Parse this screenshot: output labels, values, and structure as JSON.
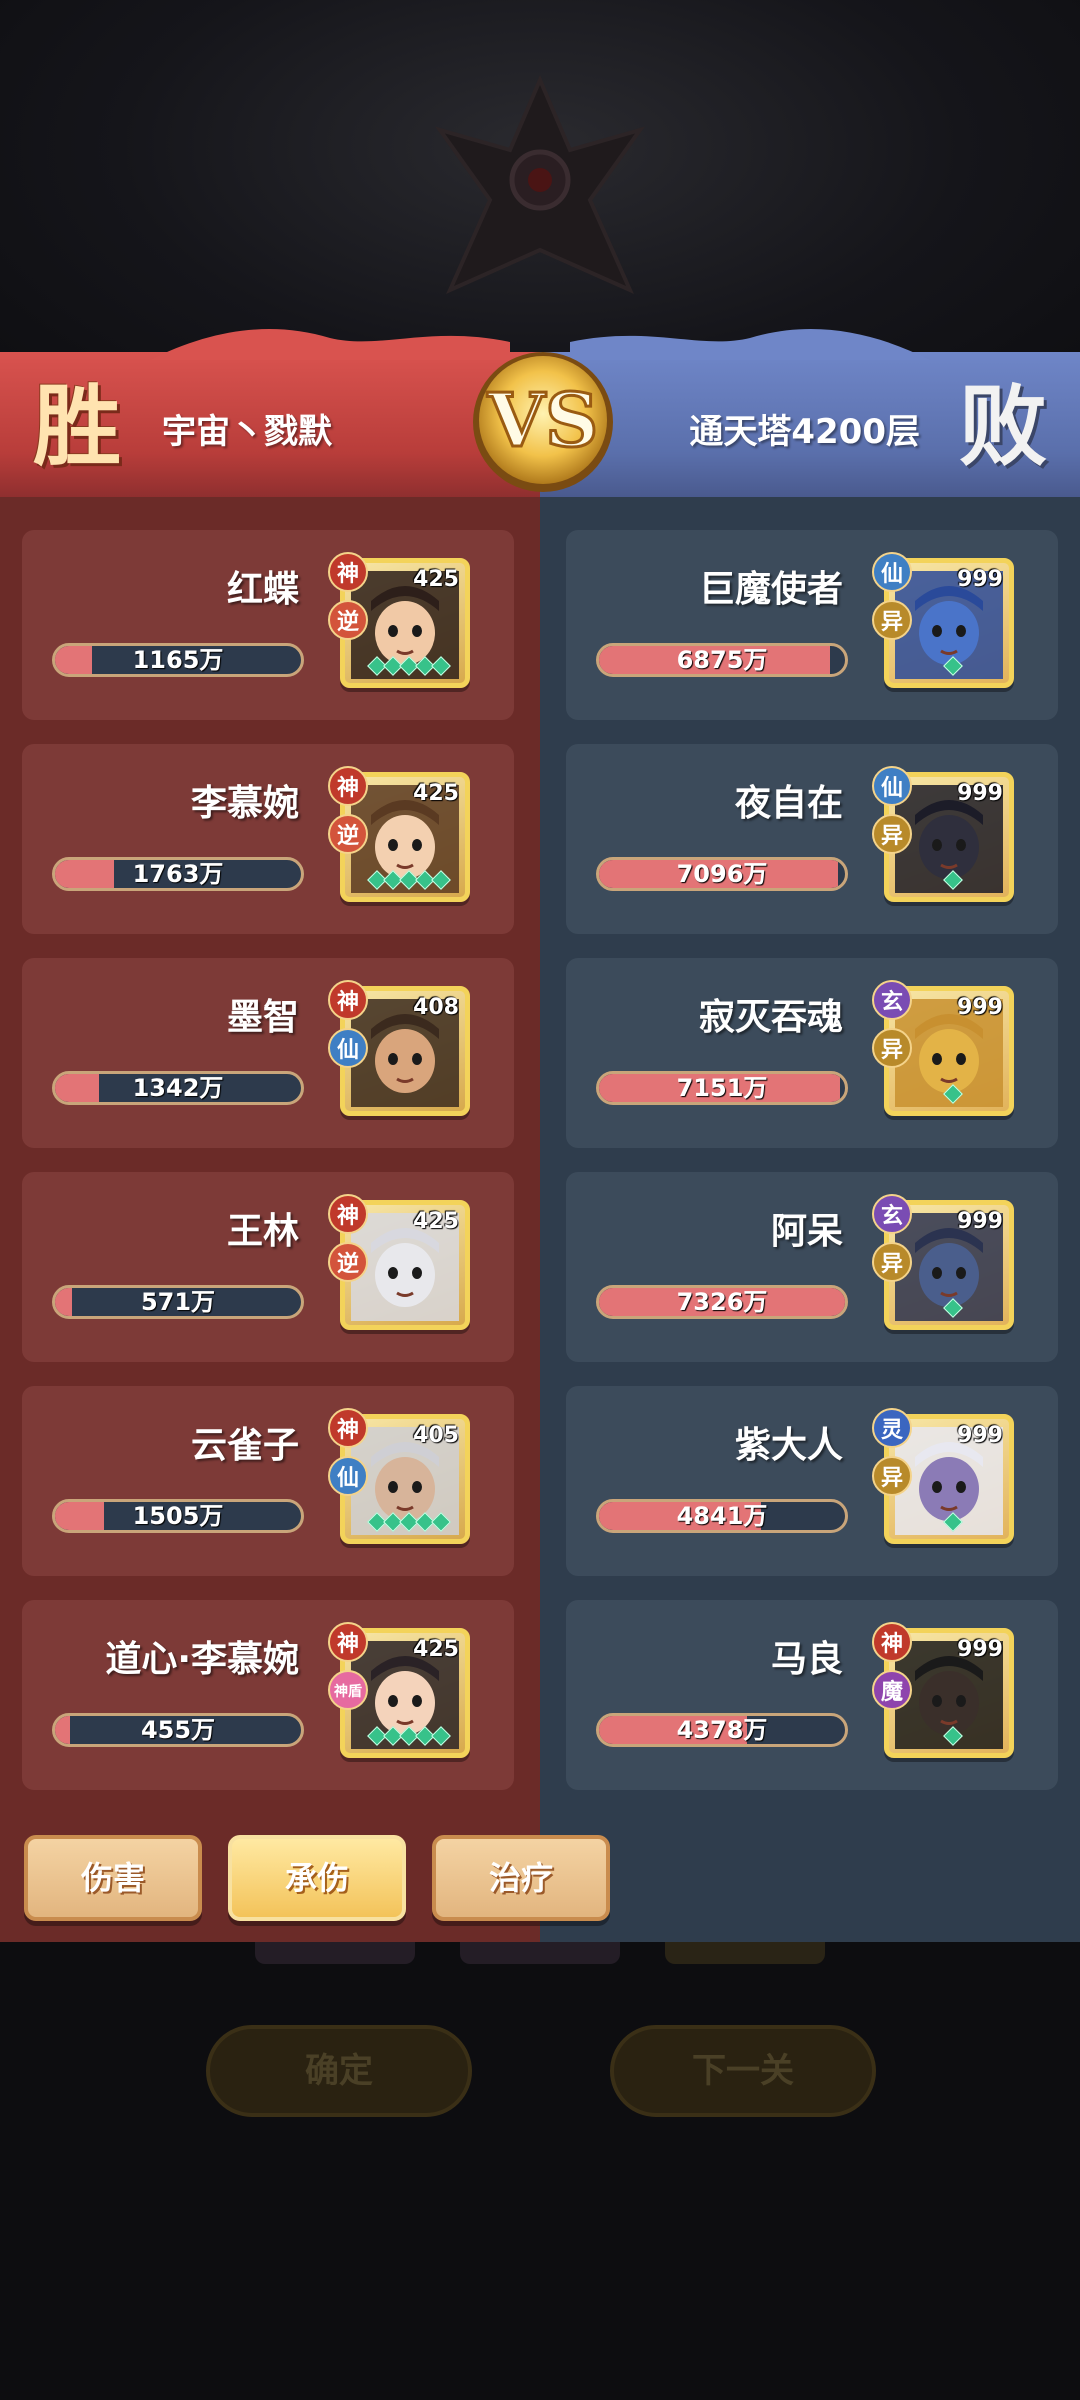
{
  "header": {
    "win_label": "胜",
    "lose_label": "败",
    "vs_label": "VS",
    "left_team": "宇宙丶戮默",
    "right_team": "通天塔4200层"
  },
  "left_heroes": [
    {
      "name": "红蝶",
      "value": "1165万",
      "ratio": 0.15,
      "level": "425",
      "tags": [
        "神",
        "逆"
      ],
      "stars": 5
    },
    {
      "name": "李慕婉",
      "value": "1763万",
      "ratio": 0.24,
      "level": "425",
      "tags": [
        "神",
        "逆"
      ],
      "stars": 5
    },
    {
      "name": "墨智",
      "value": "1342万",
      "ratio": 0.18,
      "level": "408",
      "tags": [
        "神",
        "仙"
      ],
      "stars": 0
    },
    {
      "name": "王林",
      "value": "571万",
      "ratio": 0.07,
      "level": "425",
      "tags": [
        "神",
        "逆"
      ],
      "stars": 0
    },
    {
      "name": "云雀子",
      "value": "1505万",
      "ratio": 0.2,
      "level": "405",
      "tags": [
        "神",
        "仙"
      ],
      "stars": 5
    },
    {
      "name": "道心·李慕婉",
      "value": "455万",
      "ratio": 0.06,
      "level": "425",
      "tags": [
        "神",
        "神盾"
      ],
      "stars": 5
    }
  ],
  "right_heroes": [
    {
      "name": "巨魔使者",
      "value": "6875万",
      "ratio": 0.94,
      "level": "999",
      "tags": [
        "仙",
        "异"
      ],
      "stars": 1
    },
    {
      "name": "夜自在",
      "value": "7096万",
      "ratio": 0.97,
      "level": "999",
      "tags": [
        "仙",
        "异"
      ],
      "stars": 1
    },
    {
      "name": "寂灭吞魂",
      "value": "7151万",
      "ratio": 0.98,
      "level": "999",
      "tags": [
        "玄",
        "异"
      ],
      "stars": 1
    },
    {
      "name": "阿呆",
      "value": "7326万",
      "ratio": 1.0,
      "level": "999",
      "tags": [
        "玄",
        "异"
      ],
      "stars": 1
    },
    {
      "name": "紫大人",
      "value": "4841万",
      "ratio": 0.66,
      "level": "999",
      "tags": [
        "灵",
        "异"
      ],
      "stars": 1
    },
    {
      "name": "马良",
      "value": "4378万",
      "ratio": 0.6,
      "level": "999",
      "tags": [
        "神",
        "魔"
      ],
      "stars": 1
    }
  ],
  "tabs": [
    {
      "label": "伤害",
      "active": false
    },
    {
      "label": "承伤",
      "active": true
    },
    {
      "label": "治疗",
      "active": false
    }
  ],
  "bottom_buttons": {
    "confirm": "确定",
    "next": "下一关"
  },
  "colors": {
    "win_panel": "#6b2b28",
    "lose_panel": "#2f3d4d",
    "bar_fill": "#e37476",
    "bar_track": "#2d3a4c"
  }
}
